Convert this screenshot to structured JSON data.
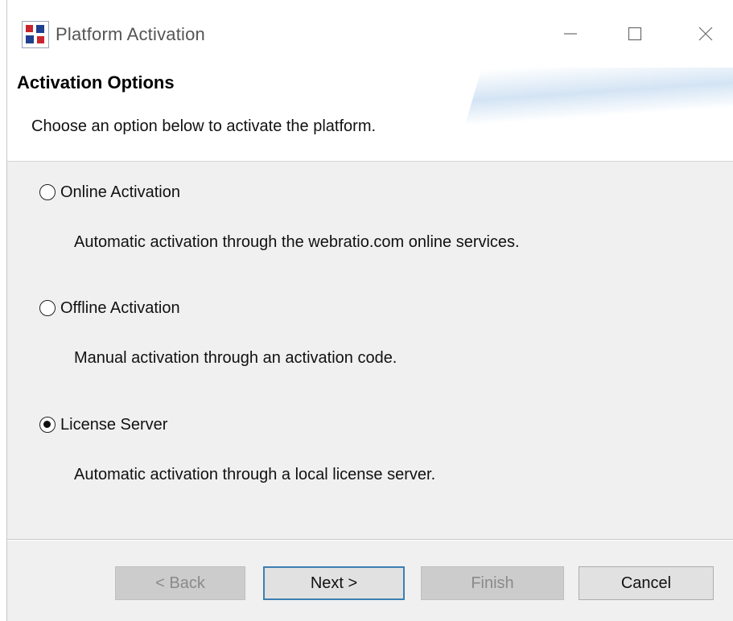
{
  "window": {
    "title": "Platform Activation",
    "icon": "app-logo-icon"
  },
  "controls": {
    "minimize_icon": "minimize-icon",
    "maximize_icon": "maximize-icon",
    "close_icon": "close-icon"
  },
  "header": {
    "title": "Activation Options",
    "description": "Choose an option below to activate the platform."
  },
  "options": [
    {
      "label": "Online Activation",
      "description": "Automatic activation through the webratio.com online services.",
      "selected": false
    },
    {
      "label": "Offline Activation",
      "description": "Manual activation through an activation code.",
      "selected": false
    },
    {
      "label": "License Server",
      "description": "Automatic activation through a local license server.",
      "selected": true
    }
  ],
  "buttons": {
    "back": "< Back",
    "next": "Next >",
    "finish": "Finish",
    "cancel": "Cancel"
  },
  "colors": {
    "default_button_border": "#3c7fb1",
    "disabled_button_bg": "#cccccc",
    "dialog_bg": "#f0f0f0"
  }
}
